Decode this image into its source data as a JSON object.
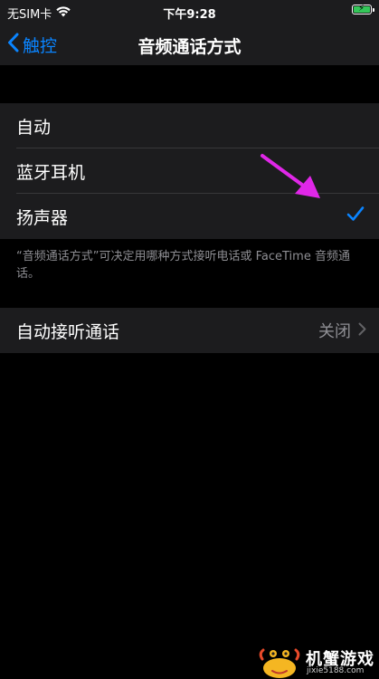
{
  "status_bar": {
    "carrier": "无SIM卡",
    "time": "下午9:28",
    "battery_color": "#34c759"
  },
  "nav": {
    "back_label": "触控",
    "title": "音频通话方式",
    "accent_color": "#0a84ff"
  },
  "routing": {
    "options": [
      "自动",
      "蓝牙耳机",
      "扬声器"
    ],
    "selected_label": "扬声器",
    "footer": "“音频通话方式”可决定用哪种方式接听电话或 FaceTime 音频通话。"
  },
  "auto_answer": {
    "label": "自动接听通话",
    "value": "关闭"
  },
  "annotation": {
    "arrow_color": "#e027e8"
  },
  "watermark": {
    "name": "机蟹游戏",
    "url": "jixie5188.com"
  }
}
